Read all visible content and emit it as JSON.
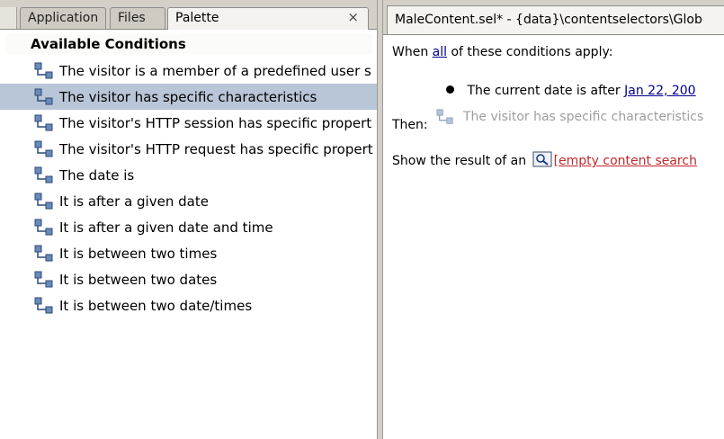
{
  "palette": {
    "tabs": [
      "Application",
      "Files",
      "Palette"
    ],
    "close_glyph": "×",
    "header": "Available Conditions",
    "icon": "user-condition-icon",
    "items": [
      "The visitor is a member of a predefined user s",
      "The visitor has specific characteristics",
      "The visitor's HTTP session has specific propert",
      "The visitor's HTTP request has specific propert",
      "The date is",
      "It is after a given date",
      "It is after a given date and time",
      "It is between two times",
      "It is between two dates",
      "It is between two date/times"
    ],
    "selected_index": 1
  },
  "editor": {
    "tab_title": "MaleContent.sel* - {data}\\contentselectors\\Glob",
    "when_prefix": "When",
    "when_link": "all",
    "when_suffix": "of these conditions apply:",
    "condition_text": "The current date is after",
    "condition_date": "Jan 22, 200",
    "then_label": "Then:",
    "dragged_item": "The visitor has specific characteristics",
    "show_prefix": "Show the result of an",
    "search_link": "[empty content search"
  },
  "colors": {
    "selection": "#b9c6d8",
    "link": "#00008b",
    "search_link": "#c0282d",
    "chrome": "#d4d0c8"
  }
}
